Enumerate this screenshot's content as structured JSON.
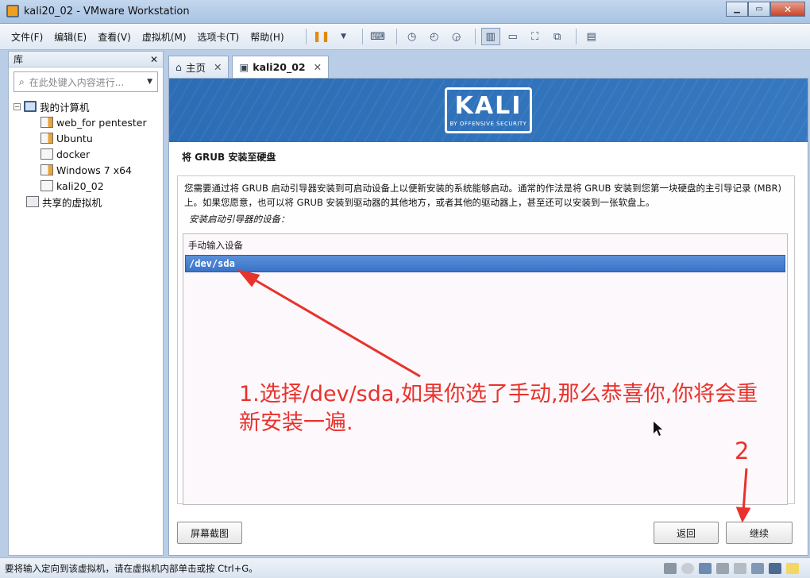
{
  "window": {
    "title": "kali20_02 - VMware Workstation"
  },
  "menu": [
    "文件(F)",
    "编辑(E)",
    "查看(V)",
    "虚拟机(M)",
    "选项卡(T)",
    "帮助(H)"
  ],
  "library": {
    "title": "库",
    "close": "✕",
    "search_placeholder": "在此处键入内容进行...",
    "tree": {
      "root": "我的计算机",
      "vms": [
        "web_for pentester",
        "Ubuntu",
        "docker",
        "Windows 7 x64",
        "kali20_02"
      ],
      "shared": "共享的虚拟机"
    }
  },
  "tabs": [
    {
      "label": "主页",
      "icon": "home-icon"
    },
    {
      "label": "kali20_02",
      "icon": "vm-icon"
    }
  ],
  "installer": {
    "brand": "KALI",
    "brand_sub": "BY OFFENSIVE SECURITY",
    "section_title": "将 GRUB 安装至硬盘",
    "description": "您需要通过将 GRUB 启动引导器安装到可启动设备上以便新安装的系统能够启动。通常的作法是将 GRUB 安装到您第一块硬盘的主引导记录 (MBR) 上。如果您愿意，也可以将 GRUB 安装到驱动器的其他地方，或者其他的驱动器上，甚至还可以安装到一张软盘上。",
    "device_prompt": "安装启动引导器的设备：",
    "list_header": "手动输入设备",
    "selected_device": "/dev/sda",
    "screenshot_button": "屏幕截图",
    "back_button": "返回",
    "continue_button": "继续"
  },
  "annotation": {
    "step1_line1": "1.选择/dev/sda,如果你选了手动,那么恭喜你,你将会重",
    "step1_line2": "新安装一遍.",
    "step2": "2",
    "color": "#e8322c"
  },
  "statusbar": {
    "text": "要将输入定向到该虚拟机，请在虚拟机内部单击或按 Ctrl+G。"
  }
}
